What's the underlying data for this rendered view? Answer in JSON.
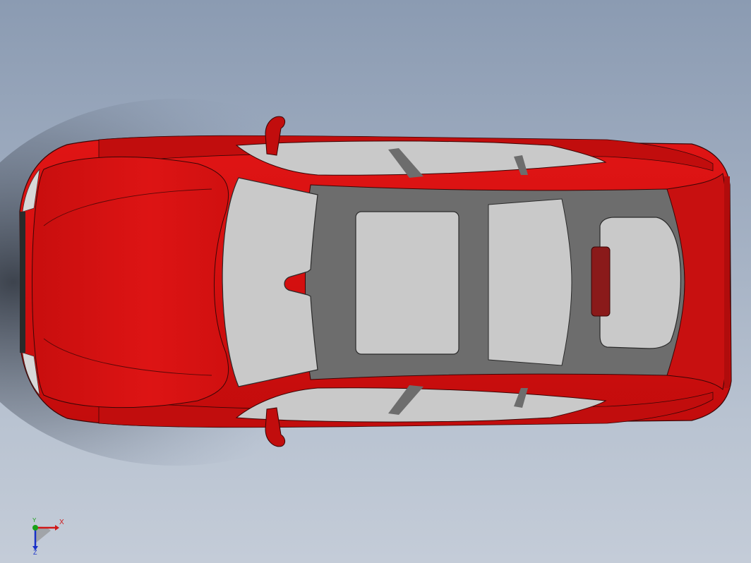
{
  "viewport": {
    "background_top": "#8b9bb2",
    "background_bottom": "#c4ccd8",
    "model": {
      "view": "top",
      "body_color": "#d40f0f",
      "glass_color": "#c9c9c9",
      "interior_color": "#6d6d6d",
      "brake_light_color": "#8a1a1a"
    }
  },
  "triad": {
    "x_label": "X",
    "y_label": "Y",
    "z_label": "Z",
    "x_color": "#d01818",
    "y_color": "#18a018",
    "z_color": "#1830c8"
  }
}
